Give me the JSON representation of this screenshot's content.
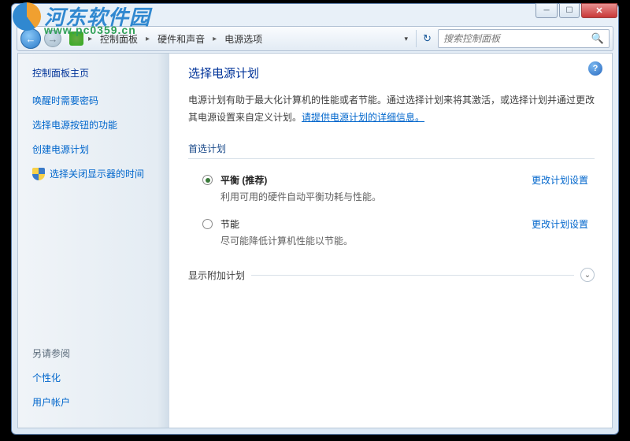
{
  "watermark": {
    "title": "河东软件园",
    "url": "www.pc0359.cn"
  },
  "window": {
    "buttons": {
      "min": "─",
      "max": "☐",
      "close": "✕"
    }
  },
  "nav": {
    "back": "←",
    "fwd": "→",
    "crumbs": [
      "控制面板",
      "硬件和声音",
      "电源选项"
    ],
    "sep": "▸",
    "dropdown": "▾",
    "refresh": "↻",
    "search_placeholder": "搜索控制面板",
    "search_icon": "🔍"
  },
  "sidebar": {
    "heading": "控制面板主页",
    "links": [
      {
        "label": "唤醒时需要密码"
      },
      {
        "label": "选择电源按钮的功能"
      },
      {
        "label": "创建电源计划"
      },
      {
        "label": "选择关闭显示器的时间"
      }
    ],
    "see_also_heading": "另请参阅",
    "see_also": [
      {
        "label": "个性化"
      },
      {
        "label": "用户帐户"
      }
    ]
  },
  "content": {
    "help": "?",
    "title": "选择电源计划",
    "description": "电源计划有助于最大化计算机的性能或者节能。通过选择计划来将其激活，或选择计划并通过更改其电源设置来自定义计划。",
    "desc_link": "请提供电源计划的详细信息。",
    "preferred_label": "首选计划",
    "plans": [
      {
        "name": "平衡 (推荐)",
        "desc": "利用可用的硬件自动平衡功耗与性能。",
        "link": "更改计划设置",
        "checked": true,
        "bold": true
      },
      {
        "name": "节能",
        "desc": "尽可能降低计算机性能以节能。",
        "link": "更改计划设置",
        "checked": false,
        "bold": false
      }
    ],
    "additional_label": "显示附加计划",
    "expand": "⌄"
  }
}
